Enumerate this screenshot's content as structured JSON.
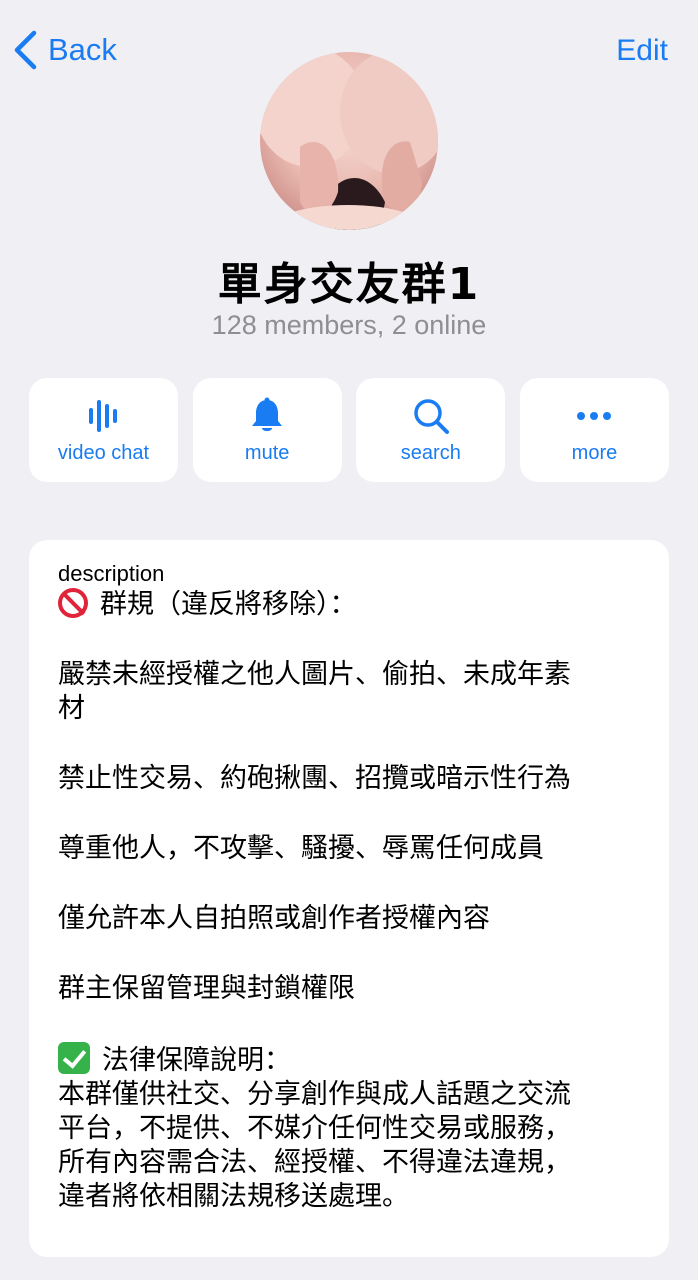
{
  "nav": {
    "back_label": "Back",
    "edit_label": "Edit"
  },
  "group": {
    "title": "單身交友群1",
    "subtitle": "128 members, 2 online"
  },
  "actions": [
    {
      "label": "video chat",
      "icon": "video-chat-icon"
    },
    {
      "label": "mute",
      "icon": "bell-icon"
    },
    {
      "label": "search",
      "icon": "search-icon"
    },
    {
      "label": "more",
      "icon": "more-dots-icon"
    }
  ],
  "description": {
    "label": "description",
    "rules_header": "群規（違反將移除）：",
    "rules": [
      "嚴禁未經授權之他人圖片、偷拍、未成年素\n材",
      "禁止性交易、約砲揪團、招攬或暗示性行為",
      "尊重他人，不攻擊、騷擾、辱罵任何成員",
      "僅允許本人自拍照或創作者授權內容",
      "群主保留管理與封鎖權限"
    ],
    "legal_header": "法律保障說明：",
    "legal_text": "本群僅供社交、分享創作與成人話題之交流\n平台，不提供、不媒介任何性交易或服務，\n所有內容需合法、經授權、不得違法違規，\n違者將依相關法規移送處理。"
  },
  "colors": {
    "accent": "#1a7cf2",
    "background": "#efeff4",
    "secondary_text": "#8e8e93"
  }
}
